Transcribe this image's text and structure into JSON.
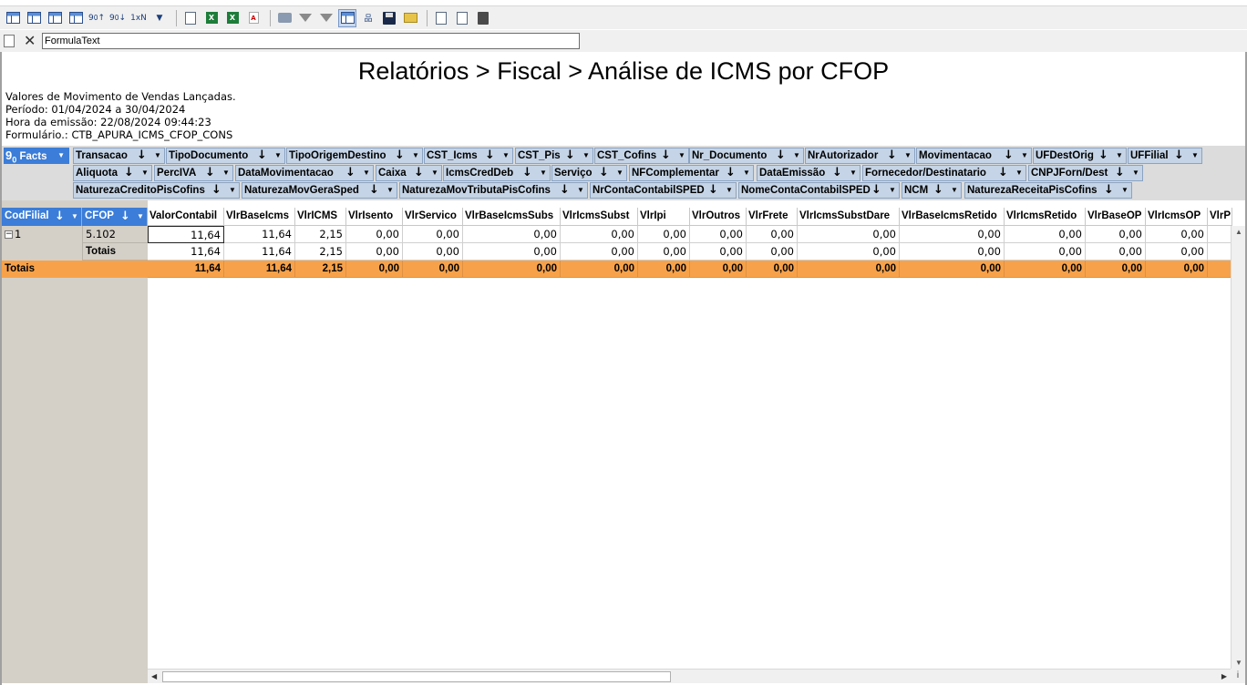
{
  "formula_bar": {
    "value": "FormulaText"
  },
  "report": {
    "title": "Relatórios > Fiscal > Análise de ICMS por CFOP",
    "info_lines": [
      "Valores de Movimento de Vendas Lançadas.",
      "Período: 01/04/2024 a 30/04/2024",
      "Hora da emissão: 22/08/2024 09:44:23",
      "Formulário.: CTB_APURA_ICMS_CFOP_CONS"
    ]
  },
  "facts_button": {
    "label": "Facts",
    "prefix": "9"
  },
  "filter_fields": [
    [
      "Transacao",
      "TipoDocumento",
      "TipoOrigemDestino",
      "CST_Icms",
      "CST_Pis",
      "CST_Cofins",
      "Nr_Documento",
      "NrAutorizador",
      "Movimentacao",
      "UFDestOrig",
      "UFFilial"
    ],
    [
      "Aliquota",
      "PercIVA",
      "DataMovimentacao",
      "Caixa",
      "IcmsCredDeb",
      "Serviço",
      "NFComplementar",
      "DataEmissão",
      "Fornecedor/Destinatario",
      "CNPJForn/Dest"
    ],
    [
      "NaturezaCreditoPisCofins",
      "NaturezaMovGeraSped",
      "NaturezaMovTributaPisCofins",
      "NrContaContabilSPED",
      "NomeContaContabilSPED",
      "NCM",
      "NaturezaReceitaPisCofins"
    ]
  ],
  "row_fields": [
    "CodFilial",
    "CFOP"
  ],
  "columns": [
    "ValorContabil",
    "VlrBaseIcms",
    "VlrICMS",
    "VlrIsento",
    "VlrServico",
    "VlrBaseIcmsSubs",
    "VlrIcmsSubst",
    "VlrIpi",
    "VlrOutros",
    "VlrFrete",
    "VlrIcmsSubstDare",
    "VlrBaseIcmsRetido",
    "VlrIcmsRetido",
    "VlrBaseOP",
    "VlrIcmsOP",
    "VlrP"
  ],
  "rows": [
    {
      "codfilial": "1",
      "cfop": "5.102",
      "values": [
        "11,64",
        "11,64",
        "2,15",
        "0,00",
        "0,00",
        "0,00",
        "0,00",
        "0,00",
        "0,00",
        "0,00",
        "0,00",
        "0,00",
        "0,00",
        "0,00",
        "0,00",
        ""
      ]
    },
    {
      "codfilial": "",
      "cfop": "Totais",
      "values": [
        "11,64",
        "11,64",
        "2,15",
        "0,00",
        "0,00",
        "0,00",
        "0,00",
        "0,00",
        "0,00",
        "0,00",
        "0,00",
        "0,00",
        "0,00",
        "0,00",
        "0,00",
        ""
      ]
    }
  ],
  "grand_total": {
    "label": "Totais",
    "values": [
      "11,64",
      "11,64",
      "2,15",
      "0,00",
      "0,00",
      "0,00",
      "0,00",
      "0,00",
      "0,00",
      "0,00",
      "0,00",
      "0,00",
      "0,00",
      "0,00",
      "0,00",
      ""
    ]
  },
  "colors": {
    "accent_blue": "#3b7dd8",
    "total_orange": "#f7a24a",
    "chip_bg": "#c5d4e6"
  },
  "toolbar_icons": [
    "pivot-grid-icon",
    "pivot-grid-2-icon",
    "pivot-grid-3-icon",
    "pivot-grid-4-icon",
    "sort-asc-9-0-icon",
    "sort-desc-9-0-icon",
    "top-n-icon",
    "dropdown-icon",
    "export-icon",
    "export-excel-icon",
    "export-excel-2-icon",
    "export-pdf-icon",
    "print-icon",
    "filter-icon",
    "clear-filter-icon",
    "grid-layout-icon",
    "hierarchy-icon",
    "save-icon",
    "open-folder-icon",
    "copy-icon",
    "paste-icon",
    "clipboard-icon"
  ]
}
